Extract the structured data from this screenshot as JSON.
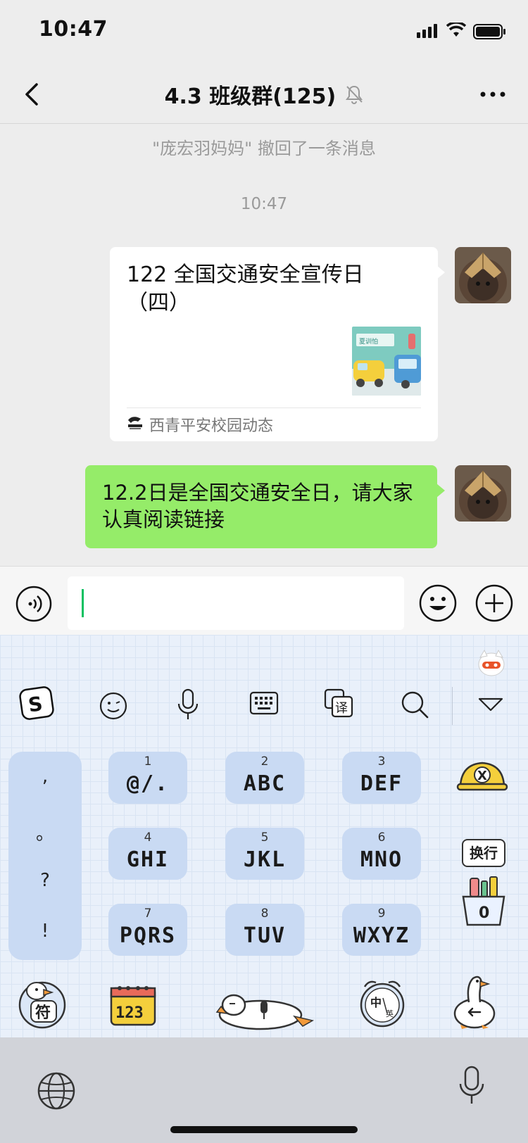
{
  "status_bar": {
    "time": "10:47"
  },
  "nav": {
    "title": "4.3 班级群(125)"
  },
  "chat": {
    "recall_notice": "\"庞宏羽妈妈\" 撤回了一条消息",
    "timestamp": "10:47",
    "link_card": {
      "title": "122 全国交通安全宣传日（四）",
      "source": "西青平安校园动态",
      "thumbnail_text": "夏训怕"
    },
    "text_message": "12.2日是全国交通安全日，请大家认真阅读链接"
  },
  "keyboard": {
    "punctuation": [
      ",",
      "。",
      "?",
      "!"
    ],
    "keys": [
      {
        "num": "1",
        "letters": "@/."
      },
      {
        "num": "2",
        "letters": "ABC"
      },
      {
        "num": "3",
        "letters": "DEF"
      },
      {
        "num": "4",
        "letters": "GHI"
      },
      {
        "num": "5",
        "letters": "JKL"
      },
      {
        "num": "6",
        "letters": "MNO"
      },
      {
        "num": "7",
        "letters": "PQRS"
      },
      {
        "num": "8",
        "letters": "TUV"
      },
      {
        "num": "9",
        "letters": "WXYZ"
      }
    ],
    "side_keys": {
      "delete": "X",
      "newline": "换行",
      "zero": "0"
    },
    "bottom": {
      "symbols": "符",
      "numbers": "123",
      "lang_zh": "中",
      "lang_en": "英"
    }
  },
  "colors": {
    "bubble_green": "#95ec69",
    "accent": "#07c160",
    "keyboard_key": "#c9daf3"
  }
}
